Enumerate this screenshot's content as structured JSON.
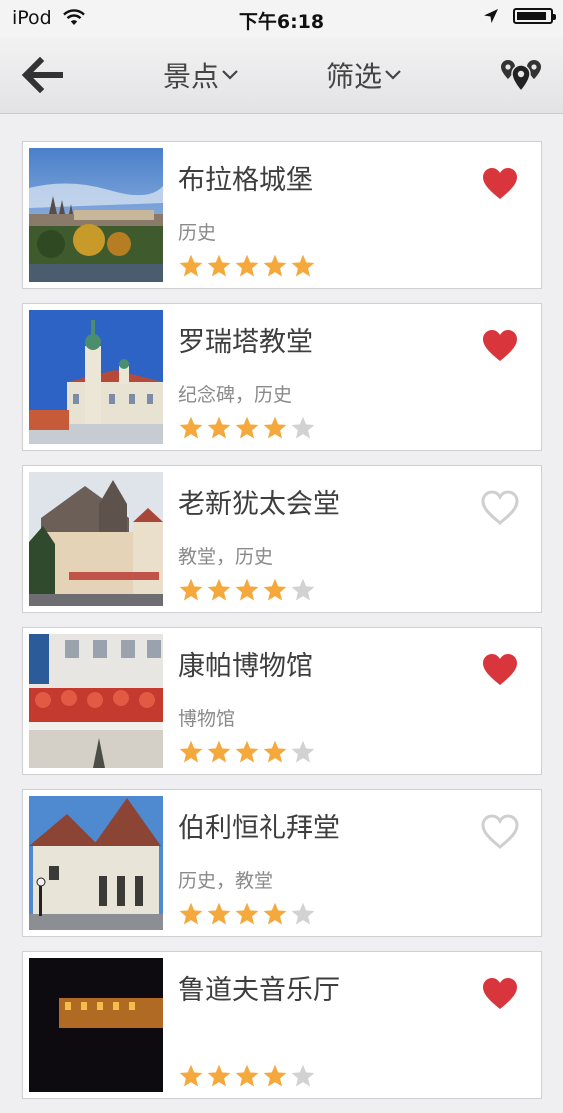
{
  "status_bar": {
    "carrier": "iPod",
    "time": "下午6:18",
    "battery_level": 0.9
  },
  "nav": {
    "back_icon": "back-arrow-icon",
    "category_dropdown": "景点",
    "filter_dropdown": "筛选",
    "map_icon": "map-pins-icon"
  },
  "colors": {
    "star_filled": "#f5a93c",
    "star_empty": "#d2d2d2",
    "heart_filled": "#d9353c",
    "heart_empty": "#cfcfcf"
  },
  "attractions": [
    {
      "title": "布拉格城堡",
      "tags": "历史",
      "rating": 5,
      "favorited": true
    },
    {
      "title": "罗瑞塔教堂",
      "tags": "纪念碑，历史",
      "rating": 4,
      "favorited": true
    },
    {
      "title": "老新犹太会堂",
      "tags": "教堂，历史",
      "rating": 4,
      "favorited": false
    },
    {
      "title": "康帕博物馆",
      "tags": "博物馆",
      "rating": 4,
      "favorited": true
    },
    {
      "title": "伯利恒礼拜堂",
      "tags": "历史，教堂",
      "rating": 4,
      "favorited": false
    },
    {
      "title": "鲁道夫音乐厅",
      "tags": "",
      "rating": 4,
      "favorited": true
    }
  ]
}
